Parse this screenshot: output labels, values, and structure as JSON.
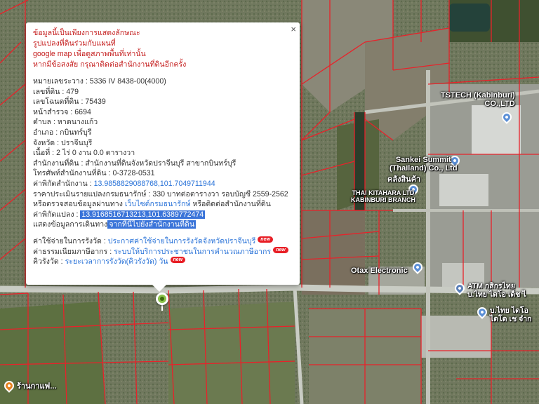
{
  "map": {
    "pois": [
      {
        "name": "tstech",
        "label": "TSTECH (Kabinburi)\nCO.,LTD"
      },
      {
        "name": "sankei",
        "label": "Sankei Summit\n(Thailand) Co., Ltd"
      },
      {
        "name": "warehouse",
        "label": "คลังสินค้า"
      },
      {
        "name": "kitahara",
        "label": "THAI KITAHARA LTD\nKABINBURI BRANCH"
      },
      {
        "name": "otax",
        "label": "Otax Electronic"
      },
      {
        "name": "atm",
        "label": "ATM กสิกรไทย\nบ.ไทย ไดโอ เด็ช ไ"
      },
      {
        "name": "thai-daido",
        "label": "บ.ไทย ไดโอ\nไดโด เช จำก"
      },
      {
        "name": "cafe",
        "label": "ร้านกาแฟ..."
      }
    ],
    "colors": {
      "parcel_line": "#e8222a",
      "road": "#c9ccc4",
      "highlight": "#3a74d9"
    }
  },
  "popup": {
    "notice": [
      "ข้อมูลนี้เป็นเพียงการแสดงลักษณะ",
      "รูปแปลงที่ดินร่วมกับแผนที่",
      "google map เพื่อดูสภาพพื้นที่เท่านั้น",
      "หากมีข้อสงสัย กรุณาติดต่อสำนักงานที่ดินอีกครั้ง"
    ],
    "fields": [
      {
        "key": "หมายเลขระวาง",
        "value": "5336 IV 8438-00(4000)"
      },
      {
        "key": "เลขที่ดิน",
        "value": "479"
      },
      {
        "key": "เลขโฉนดที่ดิน",
        "value": "75439"
      },
      {
        "key": "หน้าสำรวจ",
        "value": "6694"
      },
      {
        "key": "ตำบล",
        "value": "หาดนางแก้ว"
      },
      {
        "key": "อำเภอ",
        "value": "กบินทร์บุรี"
      },
      {
        "key": "จังหวัด",
        "value": "ปราจีนบุรี"
      },
      {
        "key": "เนื้อที่",
        "value": "2 ไร่ 0 งาน 0.0 ตารางวา"
      },
      {
        "key": "สำนักงานที่ดิน",
        "value": "สำนักงานที่ดินจังหวัดปราจีนบุรี สาขากบินทร์บุรี"
      },
      {
        "key": "โทรศัพท์สำนักงานที่ดิน",
        "value": "0-3728-0531"
      }
    ],
    "office_coord_key": "ค่าพิกัดสำนักงาน",
    "office_coord": "13.98588290887​68,101.7049711944",
    "price_line": "ราคาประเมินรายแปลงกรมธนารักษ์ : 330 บาทต่อตารางวา รอบบัญชี 2559-2562",
    "check_prefix": "หรือตรวจสอบข้อมูลผ่านทาง",
    "check_link": "เว็บไซต์กรมธนารักษ์",
    "check_suffix": "หรือติดต่อสำนักงานที่ดิน",
    "parcel_coord_key": "ค่าพิกัดแปลง",
    "parcel_coord": "13.91685167132​13,101.6389772474",
    "route_prefix": "แสดงข้อมูลการเดินทาง",
    "route_link": "จากที่นี่ไปยังสำนักงานที่ดิน",
    "fees": [
      {
        "key": "ค่าใช้จ่ายในการรังวัด",
        "link": "ประกาศค่าใช้จ่ายในการรังวัดจังหวัดปราจีนบุรี",
        "badge": "new"
      },
      {
        "key": "ค่าธรรมเนียมภาษีอากร",
        "link": "ระบบให้บริการประชาชนในการคำนวณภาษีอากร",
        "badge": "new"
      },
      {
        "key": "คิวรังวัด",
        "link": "ระยะเวลาการรังวัด(คิวรังวัด) วัน",
        "badge": "new"
      }
    ],
    "close_symbol": "×"
  }
}
